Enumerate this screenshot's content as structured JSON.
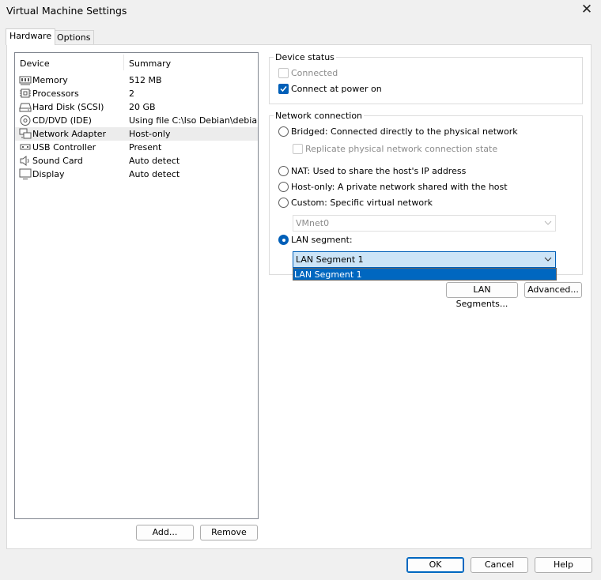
{
  "window": {
    "title": "Virtual Machine Settings"
  },
  "tabs": [
    {
      "label": "Hardware",
      "active": true
    },
    {
      "label": "Options",
      "active": false
    }
  ],
  "device_list": {
    "headers": {
      "device": "Device",
      "summary": "Summary"
    },
    "items": [
      {
        "device": "Memory",
        "summary": "512 MB",
        "icon": "memory-icon",
        "selected": false
      },
      {
        "device": "Processors",
        "summary": "2",
        "icon": "processor-icon",
        "selected": false
      },
      {
        "device": "Hard Disk (SCSI)",
        "summary": "20 GB",
        "icon": "hard-disk-icon",
        "selected": false
      },
      {
        "device": "CD/DVD (IDE)",
        "summary": "Using file C:\\Iso Debian\\debia...",
        "icon": "cd-dvd-icon",
        "selected": false
      },
      {
        "device": "Network Adapter",
        "summary": "Host-only",
        "icon": "network-adapter-icon",
        "selected": true
      },
      {
        "device": "USB Controller",
        "summary": "Present",
        "icon": "usb-icon",
        "selected": false
      },
      {
        "device": "Sound Card",
        "summary": "Auto detect",
        "icon": "speaker-icon",
        "selected": false
      },
      {
        "device": "Display",
        "summary": "Auto detect",
        "icon": "monitor-icon",
        "selected": false
      }
    ]
  },
  "buttons": {
    "add": "Add...",
    "remove": "Remove",
    "lan_segments": "LAN Segments...",
    "advanced": "Advanced...",
    "ok": "OK",
    "cancel": "Cancel",
    "help": "Help"
  },
  "device_status": {
    "label": "Device status",
    "connected": {
      "label": "Connected",
      "checked": false,
      "enabled": false
    },
    "connect_at_power_on": {
      "label": "Connect at power on",
      "checked": true,
      "enabled": true
    }
  },
  "network_connection": {
    "label": "Network connection",
    "bridged": "Bridged: Connected directly to the physical network",
    "replicate": "Replicate physical network connection state",
    "nat": "NAT: Used to share the host's IP address",
    "host_only": "Host-only: A private network shared with the host",
    "custom": "Custom: Specific virtual network",
    "custom_value": "VMnet0",
    "lan_segment": "LAN segment:",
    "lan_segment_value": "LAN Segment 1",
    "dropdown_options": [
      "LAN Segment 1"
    ],
    "selected": "lan_segment"
  },
  "colors": {
    "accent": "#005fb8",
    "selection": "#0067c0",
    "combo_active_bg": "#cce4f7"
  }
}
